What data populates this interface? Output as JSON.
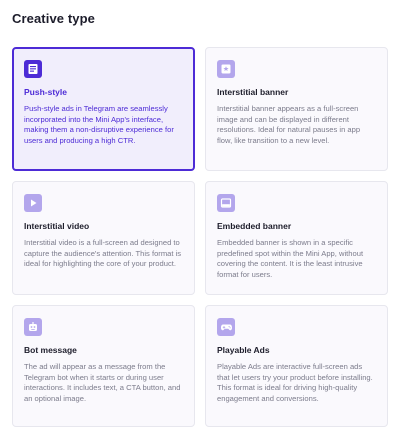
{
  "header": {
    "title": "Creative type"
  },
  "cards": [
    {
      "title": "Push-style",
      "description": "Push-style ads in Telegram are seamlessly incorporated into the Mini App's interface, making them a non-disruptive experience for users and producing a high CTR.",
      "icon": "document-list-icon",
      "selected": true
    },
    {
      "title": "Interstitial banner",
      "description": "Interstitial banner appears as a full-screen image and can be displayed in different resolutions. Ideal for natural pauses in app flow, like transition to a new level.",
      "icon": "image-star-icon",
      "selected": false
    },
    {
      "title": "Interstitial video",
      "description": "Interstitial video is a full-screen ad designed to capture the audience's attention. This format is ideal for highlighting the core of your product.",
      "icon": "video-play-icon",
      "selected": false
    },
    {
      "title": "Embedded banner",
      "description": "Embedded banner is shown in a specific predefined spot within the Mini App, without covering the content. It is the least intrusive format for users.",
      "icon": "embedded-banner-icon",
      "selected": false
    },
    {
      "title": "Bot message",
      "description": "The ad will appear as a message from the Telegram bot when it starts or during user interactions. It includes text, a CTA button, and an optional image.",
      "icon": "bot-icon",
      "selected": false
    },
    {
      "title": "Playable Ads",
      "description": "Playable Ads are interactive full-screen ads that let users try your product before installing. This format is ideal for driving high-quality engagement and conversions.",
      "icon": "gamepad-icon",
      "selected": false
    }
  ],
  "colors": {
    "accent": "#4d2bd6",
    "selected_bg": "#f1eefc",
    "icon_inactive": "#b3a6ec",
    "card_bg": "#faf9fd"
  }
}
